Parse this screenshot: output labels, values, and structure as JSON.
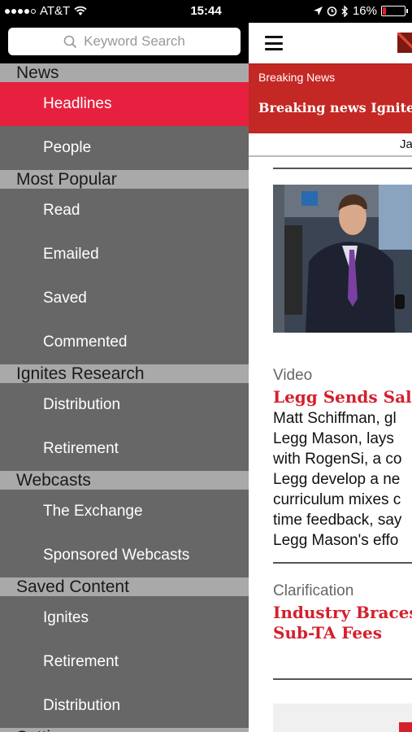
{
  "status_bar": {
    "carrier": "AT&T",
    "time": "15:44",
    "battery": "16%",
    "battery_level": 0.16,
    "battery_color": "#e0202a"
  },
  "search": {
    "placeholder": "Keyword Search"
  },
  "sections": [
    {
      "header": "News",
      "items": [
        "Headlines",
        "People"
      ],
      "active": "Headlines"
    },
    {
      "header": "Most Popular",
      "items": [
        "Read",
        "Emailed",
        "Saved",
        "Commented"
      ]
    },
    {
      "header": "Ignites Research",
      "items": [
        "Distribution",
        "Retirement"
      ]
    },
    {
      "header": "Webcasts",
      "items": [
        "The Exchange",
        "Sponsored Webcasts"
      ]
    },
    {
      "header": "Saved Content",
      "items": [
        "Ignites",
        "Retirement",
        "Distribution"
      ]
    },
    {
      "header": "Settings",
      "items": []
    }
  ],
  "colors": {
    "accent": "#e6203e",
    "sidebar_bg": "#676767",
    "section_header_bg": "#a9a9a9",
    "breaking_bg": "#c42824",
    "headline_red": "#d4202c"
  },
  "content": {
    "breaking_label": "Breaking News",
    "breaking_headline": "Breaking news Ignites",
    "date_partial": "Ja",
    "article1": {
      "type": "Video",
      "title": "Legg Sends Sale",
      "body": "Matt Schiffman, gl\nLegg Mason, lays \nwith RogenSi, a co\nLegg develop a ne\ncurriculum mixes c\ntime feedback, say\nLegg Mason's effo"
    },
    "article2": {
      "type": "Clarification",
      "title_line1": "Industry Braces",
      "title_line2": "Sub-TA Fees"
    }
  }
}
